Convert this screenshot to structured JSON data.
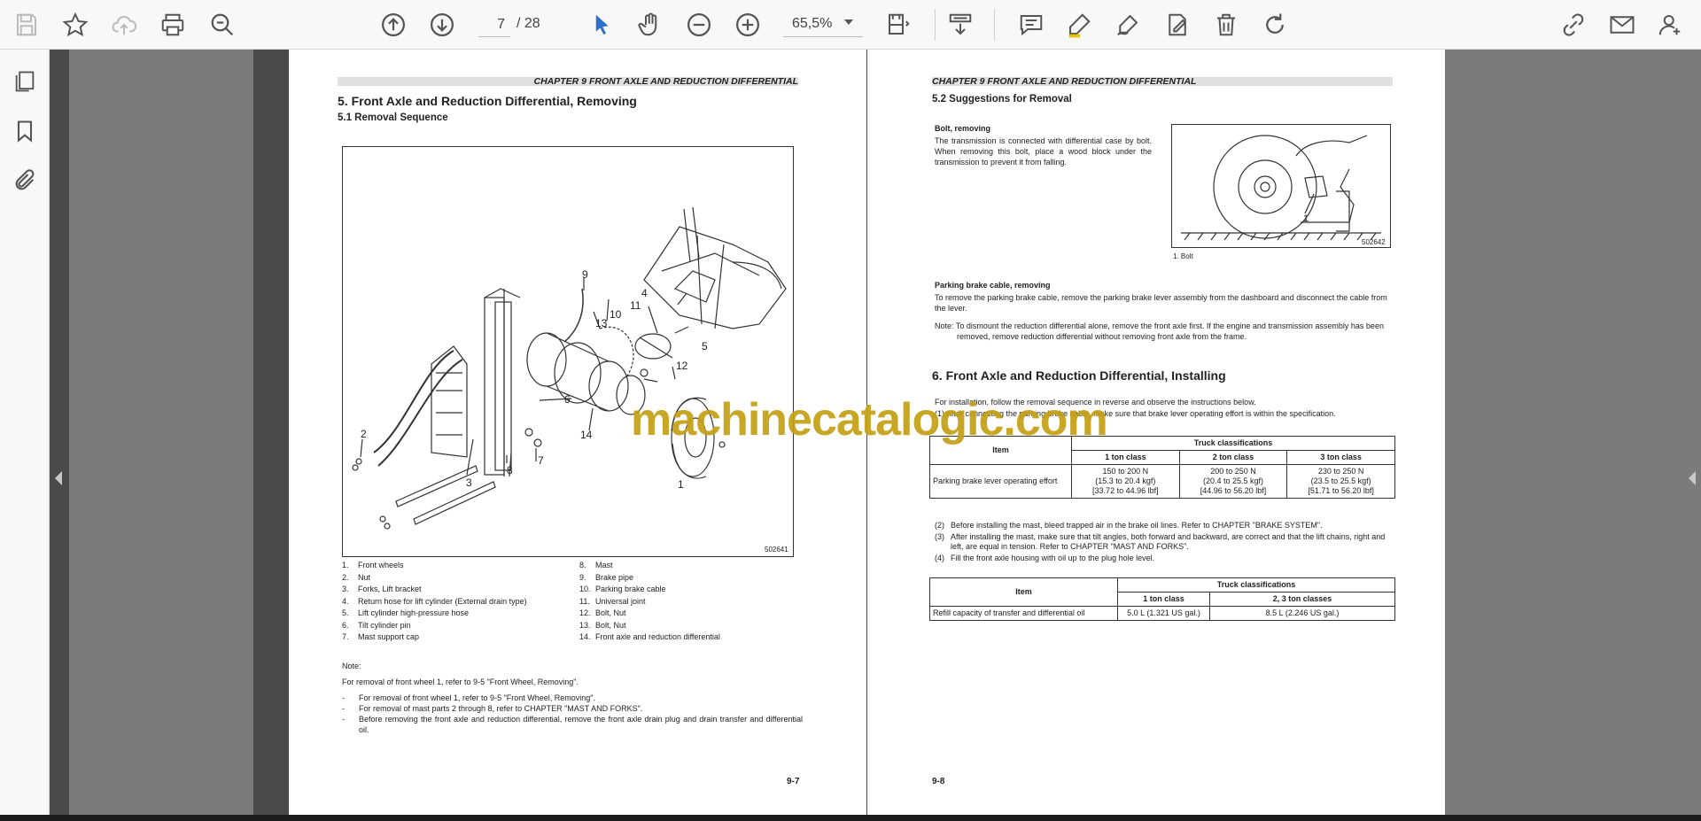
{
  "toolbar": {
    "current_page": "7",
    "page_total": "/ 28",
    "zoom": "65,5%"
  },
  "watermark": "machinecatalogic.com",
  "left_page": {
    "header": "CHAPTER 9 FRONT AXLE AND REDUCTION DIFFERENTIAL",
    "section_title": "5.    Front Axle and Reduction Differential, Removing",
    "subsection_title": "5.1       Removal Sequence",
    "figure_code": "502641",
    "callouts": [
      "1",
      "2",
      "3",
      "4",
      "5",
      "6",
      "7",
      "8",
      "9",
      "10",
      "11",
      "12",
      "13",
      "14"
    ],
    "captions_left": [
      {
        "n": "1.",
        "text": "Front wheels"
      },
      {
        "n": "2.",
        "text": "Nut"
      },
      {
        "n": "3.",
        "text": "Forks, Lift bracket"
      },
      {
        "n": "4.",
        "text": "Return hose for lift cylinder (External drain type)"
      },
      {
        "n": "5.",
        "text": "Lift cylinder high-pressure hose"
      },
      {
        "n": "6.",
        "text": "Tilt cylinder pin"
      },
      {
        "n": "7.",
        "text": "Mast support cap"
      }
    ],
    "captions_right": [
      {
        "n": "8.",
        "text": "Mast"
      },
      {
        "n": "9.",
        "text": "Brake pipe"
      },
      {
        "n": "10.",
        "text": "Parking brake cable"
      },
      {
        "n": "11.",
        "text": "Universal joint"
      },
      {
        "n": "12.",
        "text": "Bolt, Nut"
      },
      {
        "n": "13.",
        "text": "Bolt, Nut"
      },
      {
        "n": "14.",
        "text": "Front axle and reduction differential"
      }
    ],
    "note_label": "Note:",
    "note_intro": "For removal of front wheel 1, refer to 9-5 \"Front Wheel, Removing\".",
    "note_items": [
      "For removal of front wheel 1, refer to 9-5 \"Front Wheel, Removing\".",
      "For removal of mast parts 2 through 8, refer to CHAPTER \"MAST AND FORKS\".",
      "Before removing the front axle and reduction differential, remove the front axle drain plug and drain transfer and differential oil."
    ],
    "page_number": "9-7"
  },
  "right_page": {
    "header": "CHAPTER 9 FRONT AXLE AND REDUCTION DIFFERENTIAL",
    "subsection_title": "5.2       Suggestions for Removal",
    "bolt_title": "Bolt, removing",
    "bolt_text": "The transmission is connected with differential case by bolt. When removing this bolt, place a wood block under the transmission to prevent it from falling.",
    "figure_code": "502642",
    "figure_callout": "1",
    "figure_caption": "1. Bolt",
    "brake_title": "Parking brake cable, removing",
    "brake_text": "To remove the parking brake cable, remove the parking brake lever assembly from the dashboard and disconnect the cable from the lever.",
    "brake_note": "Note: To dismount the reduction differential alone, remove the front axle first. If the engine and transmission assembly has been removed, remove reduction differential without removing front axle from the frame.",
    "section_title": "6.    Front Axle and Reduction Differential, Installing",
    "install_intro": "For installation, follow the removal sequence in reverse and observe the instructions below.",
    "install_item1": "(1)  After connecting the parking brake cable, make sure that brake lever operating effort is within the specification.",
    "table1": {
      "item_header": "Item",
      "group_header": "Truck classifications",
      "cols": [
        "1 ton class",
        "2 ton class",
        "3 ton class"
      ],
      "row_label": "Parking brake lever operating effort",
      "cells": [
        [
          "150 to 200 N",
          "(15.3 to 20.4 kgf)",
          "[33.72 to 44.96 lbf]"
        ],
        [
          "200 to 250 N",
          "(20.4 to 25.5 kgf)",
          "[44.96 to 56.20 lbf]"
        ],
        [
          "230 to 250 N",
          "(23.5 to 25.5 kgf)",
          "[51.71 to 56.20 lbf]"
        ]
      ]
    },
    "install_items": [
      {
        "n": "(2)",
        "text": "Before installing the mast, bleed trapped air in the brake oil lines. Refer to CHAPTER \"BRAKE SYSTEM\"."
      },
      {
        "n": "(3)",
        "text": "After installing the mast, make sure that tilt angles, both forward and backward, are correct and that the lift chains, right and left, are equal in tension. Refer to CHAPTER \"MAST AND FORKS\"."
      },
      {
        "n": "(4)",
        "text": "Fill the front axle housing with oil up to the plug hole level."
      }
    ],
    "table2": {
      "item_header": "Item",
      "group_header": "Truck classifications",
      "cols": [
        "1 ton class",
        "2, 3 ton classes"
      ],
      "row_label": "Refill capacity of transfer and differential oil",
      "cells": [
        "5.0 L (1.321 US gal.)",
        "8.5 L (2.246 US gal.)"
      ]
    },
    "page_number": "9-8"
  }
}
